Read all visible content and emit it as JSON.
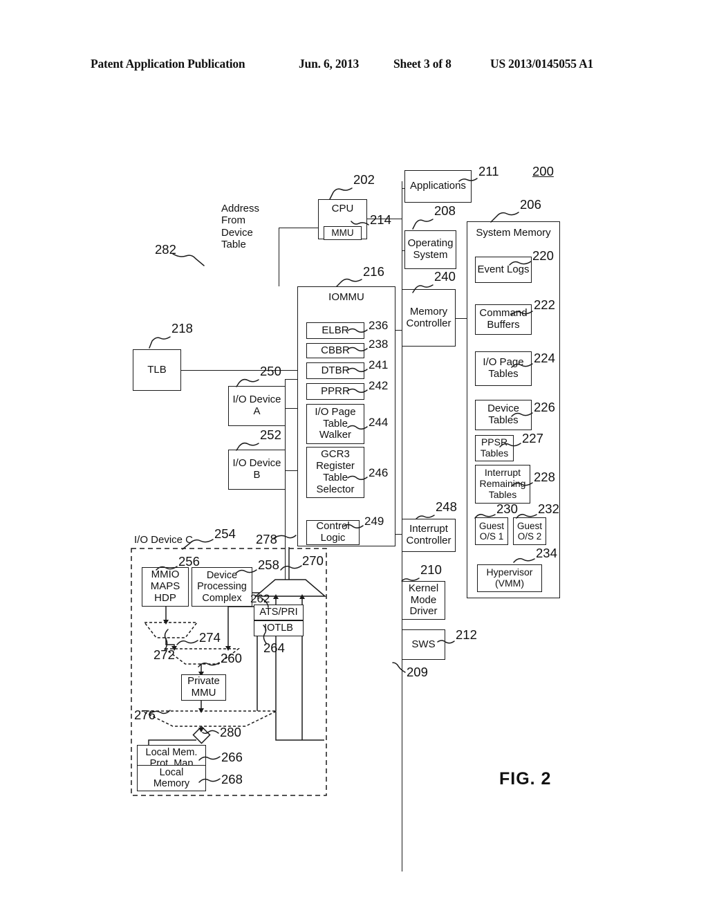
{
  "header": {
    "publication": "Patent Application Publication",
    "date": "Jun. 6, 2013",
    "sheet": "Sheet 3 of 8",
    "number": "US 2013/0145055 A1"
  },
  "figure": {
    "caption": "FIG. 2",
    "system_ref": "200"
  },
  "labels": {
    "address_from_device_table": "Address\nFrom\nDevice\nTable",
    "io_device_c_title": "I/O Device C"
  },
  "blocks": {
    "cpu": {
      "label": "CPU",
      "ref": "202"
    },
    "mmu": {
      "label": "MMU",
      "ref": "214"
    },
    "applications": {
      "label": "Applications",
      "ref": "211"
    },
    "operating_system": {
      "label": "Operating\nSystem",
      "ref": "208"
    },
    "memory_controller": {
      "label": "Memory\nController",
      "ref": "240"
    },
    "interrupt_controller": {
      "label": "Interrupt\nController",
      "ref": "248"
    },
    "kernel_mode_driver": {
      "label": "Kernel\nMode\nDriver",
      "ref": "210"
    },
    "sws": {
      "label": "SWS",
      "ref": "212"
    },
    "software_stack": {
      "ref": "209"
    },
    "tlb": {
      "label": "TLB",
      "ref": "218"
    },
    "iommu": {
      "label": "IOMMU",
      "ref": "216"
    },
    "address_bus": {
      "ref": "282"
    },
    "elbr": {
      "label": "ELBR",
      "ref": "236"
    },
    "cbbr": {
      "label": "CBBR",
      "ref": "238"
    },
    "dtbr": {
      "label": "DTBR",
      "ref": "241"
    },
    "pprr": {
      "label": "PPRR",
      "ref": "242"
    },
    "io_page_table_walker": {
      "label": "I/O Page\nTable\nWalker",
      "ref": "244"
    },
    "gcr3_selector": {
      "label": "GCR3\nRegister\nTable\nSelector",
      "ref": "246"
    },
    "control_logic": {
      "label": "Control\nLogic",
      "ref": "249"
    },
    "io_device_a": {
      "label": "I/O Device\nA",
      "ref": "250"
    },
    "io_device_b": {
      "label": "I/O Device\nB",
      "ref": "252"
    },
    "io_device_c": {
      "ref": "254"
    },
    "system_memory": {
      "label": "System Memory",
      "ref": "206"
    },
    "event_logs": {
      "label": "Event Logs",
      "ref": "220"
    },
    "command_buffers": {
      "label": "Command\nBuffers",
      "ref": "222"
    },
    "io_page_tables": {
      "label": "I/O Page\nTables",
      "ref": "224"
    },
    "device_tables": {
      "label": "Device\nTables",
      "ref": "226"
    },
    "ppsr_tables": {
      "label": "PPSR\nTables",
      "ref": "227"
    },
    "interrupt_remaining_tables": {
      "label": "Interrupt\nRemaining\nTables",
      "ref": "228"
    },
    "guest_os_1": {
      "label": "Guest\nO/S 1",
      "ref": "230"
    },
    "guest_os_2": {
      "label": "Guest\nO/S 2",
      "ref": "232"
    },
    "hypervisor": {
      "label": "Hypervisor\n(VMM)",
      "ref": "234"
    },
    "mmio_maps_hdp": {
      "label": "MMIO\nMAPS\nHDP",
      "ref": "256"
    },
    "device_processing_complex": {
      "label": "Device\nProcessing\nComplex",
      "ref": "258"
    },
    "ats_pri": {
      "label": "ATS/PRI",
      "ref": "262"
    },
    "iotlb": {
      "label": "IOTLB",
      "ref": "264"
    },
    "private_mmu": {
      "label": "Private\nMMU",
      "ref": "260"
    },
    "local_mem_prot_map": {
      "label": "Local Mem.\nProt. Map",
      "ref": "266"
    },
    "local_memory": {
      "label": "Local\nMemory",
      "ref": "268"
    },
    "mux_270": {
      "ref": "270"
    },
    "mux_272": {
      "ref": "272"
    },
    "mux_274": {
      "ref": "274"
    },
    "mux_276": {
      "ref": "276"
    },
    "switch_280": {
      "ref": "280"
    },
    "device_bus_278": {
      "ref": "278"
    }
  }
}
